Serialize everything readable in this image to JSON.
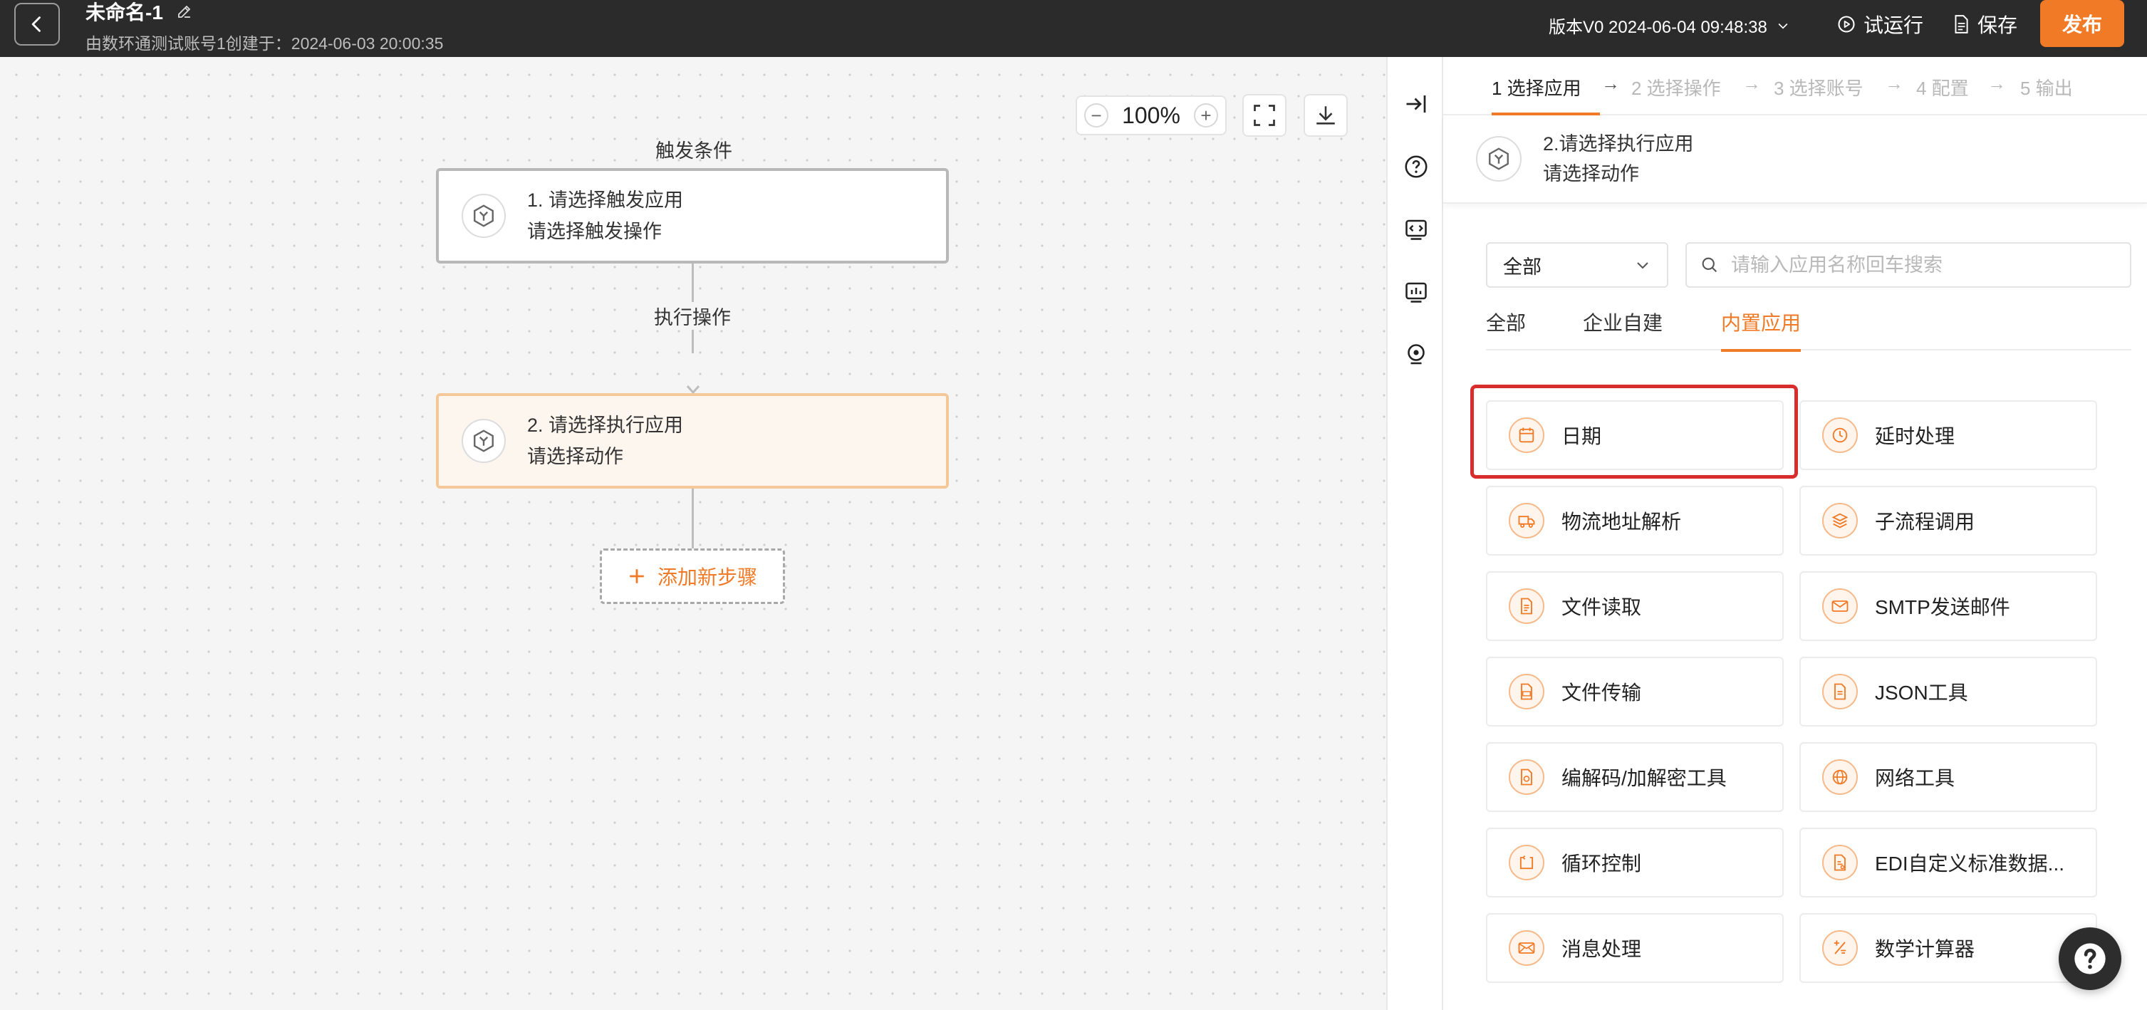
{
  "header": {
    "title": "未命名-1",
    "subtitle": "由数环通测试账号1创建于：2024-06-03 20:00:35",
    "version": "版本V0 2024-06-04 09:48:38",
    "test_run": "试运行",
    "save": "保存",
    "publish": "发布"
  },
  "canvas": {
    "zoom": "100%",
    "trigger_label": "触发条件",
    "action_label": "执行操作",
    "trigger_node": {
      "title": "1. 请选择触发应用",
      "subtitle": "请选择触发操作"
    },
    "action_node": {
      "title": "2. 请选择执行应用",
      "subtitle": "请选择动作"
    },
    "add_step": "添加新步骤"
  },
  "panel": {
    "steps": [
      "1 选择应用",
      "2 选择操作",
      "3 选择账号",
      "4 配置",
      "5 输出"
    ],
    "selected": {
      "title": "2.请选择执行应用",
      "subtitle": "请选择动作"
    },
    "dropdown": "全部",
    "search_placeholder": "请输入应用名称回车搜索",
    "tabs": [
      "全部",
      "企业自建",
      "内置应用"
    ],
    "active_tab": "内置应用",
    "apps": [
      {
        "name": "日期",
        "icon": "calendar-icon"
      },
      {
        "name": "延时处理",
        "icon": "clock-icon"
      },
      {
        "name": "物流地址解析",
        "icon": "truck-icon"
      },
      {
        "name": "子流程调用",
        "icon": "layers-icon"
      },
      {
        "name": "文件读取",
        "icon": "file-read-icon"
      },
      {
        "name": "SMTP发送邮件",
        "icon": "mail-icon"
      },
      {
        "name": "文件传输",
        "icon": "ftp-icon"
      },
      {
        "name": "JSON工具",
        "icon": "json-icon"
      },
      {
        "name": "编解码/加解密工具",
        "icon": "codec-icon"
      },
      {
        "name": "网络工具",
        "icon": "globe-icon"
      },
      {
        "name": "循环控制",
        "icon": "loop-icon"
      },
      {
        "name": "EDI自定义标准数据...",
        "icon": "edi-icon"
      },
      {
        "name": "消息处理",
        "icon": "message-icon"
      },
      {
        "name": "数学计算器",
        "icon": "calculator-icon"
      }
    ]
  },
  "colors": {
    "accent": "#f07a26",
    "header_bg": "#2b2b2b",
    "highlight": "#d92c2c"
  }
}
